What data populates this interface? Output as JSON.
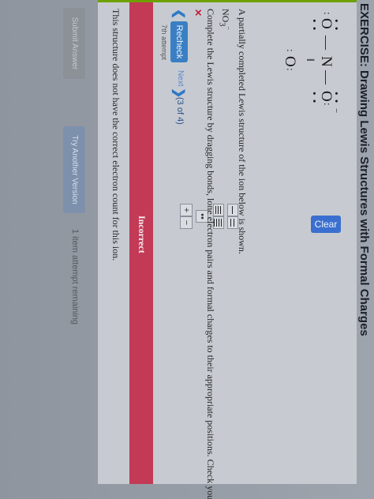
{
  "exercise_title": "EXERCISE: Drawing Lewis Structures with Formal Charges",
  "toolbar": {
    "clear_label": "Clear",
    "plus_label": "+",
    "minus_label": "−",
    "lone_pair_label": "••"
  },
  "lewis": {
    "left_o": "O",
    "n": "N",
    "right_o": "O",
    "bottom_o": "O",
    "right_o_charge": "−"
  },
  "question": {
    "intro": "A partially completed Lewis structure of the ion below is shown.",
    "formula_main": "NO",
    "formula_sub": "3",
    "formula_sup": "−",
    "instructions": "Complete the Lewis structure by dragging bonds, lone electron pairs and formal charges to their appropriate positions. Check you"
  },
  "nav": {
    "recheck_label": "Recheck",
    "next_label": "Next",
    "counter": "(3 of 4)",
    "attempt": "7th attempt"
  },
  "result": {
    "banner": "Incorrect",
    "feedback": "This structure does not have the correct electron count for this ion."
  },
  "footer": {
    "submit_label": "Submit Answer",
    "try_label": "Try Another Version",
    "remaining": "1 item attempt remaining"
  },
  "colors": {
    "banner": "#c23a55",
    "accent_blue": "#3a6fcf",
    "error_x": "#c0203a"
  }
}
